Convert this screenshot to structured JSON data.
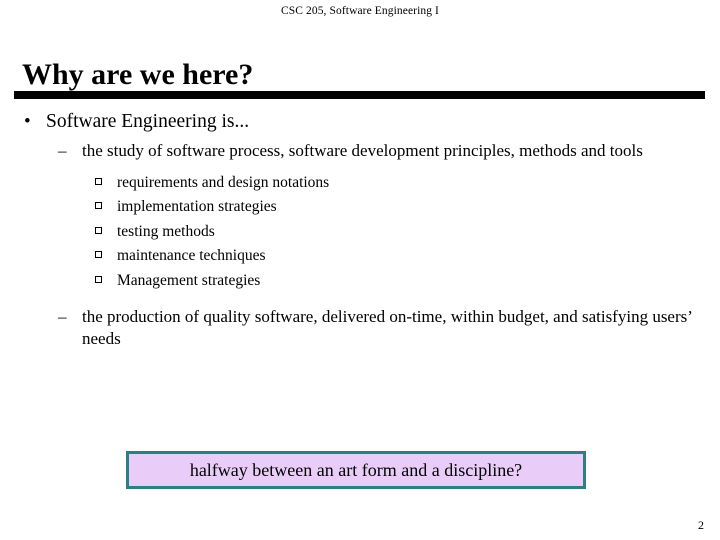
{
  "slide": {
    "header": "CSC 205, Software Engineering I",
    "title": "Why are we here?",
    "page_number": "2",
    "markers": {
      "level1": "•",
      "level2": "–"
    },
    "bullets": {
      "level1_text": "Software Engineering is...",
      "definition_1": "the study of software process, software development principles, methods and tools",
      "sub_items": [
        "requirements and design notations",
        "implementation strategies",
        "testing methods",
        "maintenance techniques",
        "Management strategies"
      ],
      "definition_2": "the production of quality software, delivered on-time, within budget, and satisfying users’ needs"
    },
    "callout": {
      "text": "halfway between an art form and a discipline?",
      "border_color": "#2d8080",
      "fill_color": "#e9ccf7"
    },
    "rule_color": "#000000"
  }
}
